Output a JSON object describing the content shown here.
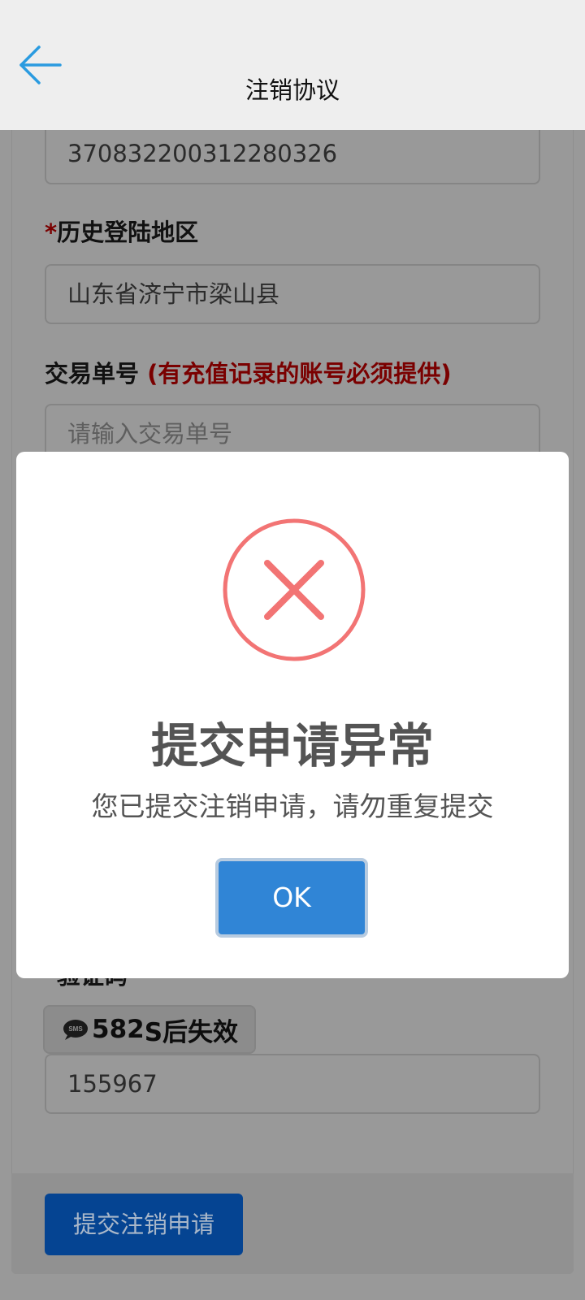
{
  "header": {
    "title": "注销协议",
    "back_icon": "arrow-left-icon"
  },
  "form": {
    "id_number_value": "370832200312280326",
    "history_region_required_mark": "*",
    "history_region_label": "历史登陆地区",
    "history_region_value": "山东省济宁市梁山县",
    "trade_no_label": "交易单号",
    "trade_no_note": "(有充值记录的账号必须提供)",
    "trade_no_placeholder": "请输入交易单号",
    "code_label_partial": "验证码",
    "sms_countdown_number": "582",
    "sms_countdown_suffix": "S后失效",
    "sms_icon": "sms-bubble-icon",
    "code_value": "155967",
    "submit_label": "提交注销申请"
  },
  "modal": {
    "icon": "error-x-icon",
    "title": "提交申请异常",
    "message": "您已提交注销申请，请勿重复提交",
    "ok_label": "OK"
  },
  "colors": {
    "overlay_bg": "#999999",
    "header_bg": "#eeeeee",
    "accent_blue": "#3085d6",
    "error_red": "#f27474",
    "submit_bg": "#054492",
    "required_red": "#7a0000"
  }
}
